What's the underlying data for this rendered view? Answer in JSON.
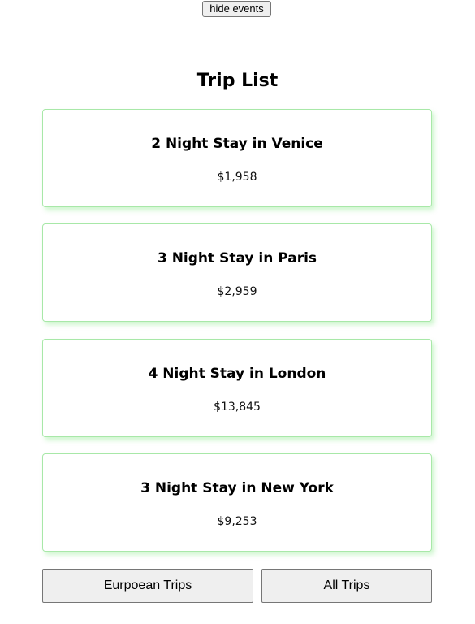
{
  "header": {
    "toggle_button_label": "hide events"
  },
  "page_title": "Trip List",
  "trips": [
    {
      "name": "2 Night Stay in Venice",
      "price": "$1,958"
    },
    {
      "name": "3 Night Stay in Paris",
      "price": "$2,959"
    },
    {
      "name": "4 Night Stay in London",
      "price": "$13,845"
    },
    {
      "name": "3 Night Stay in New York",
      "price": "$9,253"
    }
  ],
  "filters": {
    "european_label": "Eurpoean Trips",
    "all_label": "All Trips"
  },
  "colors": {
    "card_border": "#a8e8a8",
    "card_shadow": "#78e678",
    "button_bg": "#efefef"
  }
}
